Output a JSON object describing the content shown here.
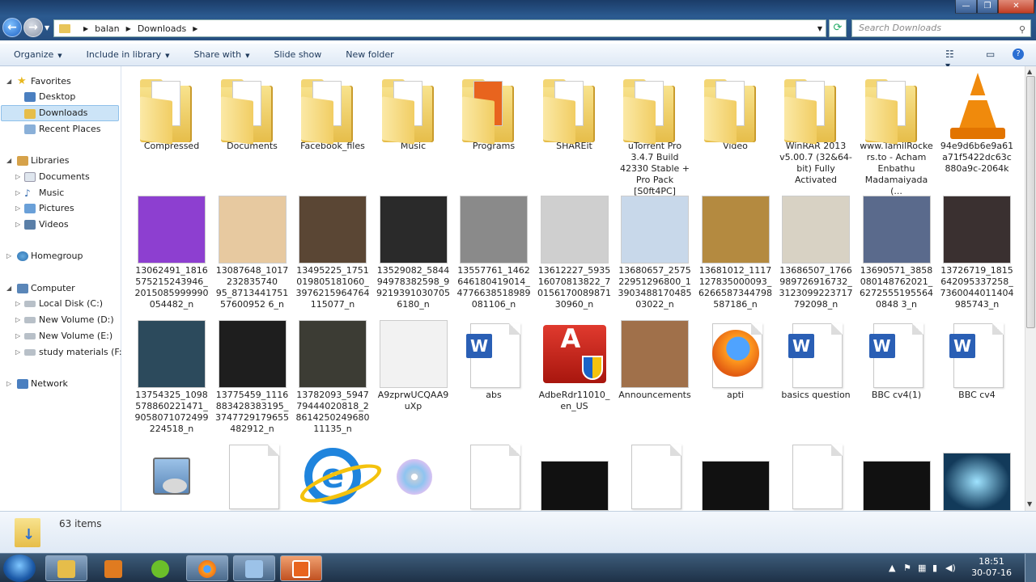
{
  "window": {
    "address": {
      "crumbs": [
        "balan",
        "Downloads"
      ]
    },
    "search_placeholder": "Search Downloads",
    "controls": {
      "minimize": "—",
      "maximize": "❐",
      "close": "✕"
    }
  },
  "toolbar": {
    "items": [
      "Organize",
      "Include in library",
      "Share with",
      "Slide show",
      "New folder"
    ]
  },
  "sidebar": {
    "favorites": {
      "label": "Favorites",
      "items": [
        "Desktop",
        "Downloads",
        "Recent Places"
      ]
    },
    "libraries": {
      "label": "Libraries",
      "items": [
        "Documents",
        "Music",
        "Pictures",
        "Videos"
      ]
    },
    "homegroup": "Homegroup",
    "computer": {
      "label": "Computer",
      "items": [
        "Local Disk (C:)",
        "New Volume (D:)",
        "New Volume (E:)",
        "study materials (F:)"
      ]
    },
    "network": "Network"
  },
  "files": {
    "row1": [
      {
        "name": "Compressed",
        "kind": "folder"
      },
      {
        "name": "Documents",
        "kind": "folder"
      },
      {
        "name": "Facebook_files",
        "kind": "folder"
      },
      {
        "name": "Music",
        "kind": "folder"
      },
      {
        "name": "Programs",
        "kind": "folder",
        "accent": "#e8641e"
      },
      {
        "name": "SHAREit",
        "kind": "folder"
      },
      {
        "name": "uTorrent Pro 3.4.7 Build 42330 Stable + Pro Pack [S0ft4PC]",
        "kind": "folder"
      },
      {
        "name": "Video",
        "kind": "folder"
      },
      {
        "name": "WinRAR 2013 v5.00.7 (32&64-bit) Fully Activated",
        "kind": "folder"
      },
      {
        "name": "www.TamilRockers.to - Acham Enbathu Madamaiyada (...",
        "kind": "folder"
      },
      {
        "name": "94e9d6b6e9a61a71f5422dc63c880a9c-2064k",
        "kind": "vlc"
      }
    ],
    "row2": [
      {
        "name": "13062491_1816575215243946_2015085999990054482_n",
        "color": "#8d3fd0"
      },
      {
        "name": "13087648_1017232835740 95_871344175157600952 6_n",
        "color": "#e7c9a0"
      },
      {
        "name": "13495225_1751019805181060_3976215964764115077_n",
        "color": "#5a4634"
      },
      {
        "name": "13529082_584494978382598_992193910307056180_n",
        "color": "#2a2a2a"
      },
      {
        "name": "13557761_1462646180419014_4776638518989081106_n",
        "color": "#8a8a8a"
      },
      {
        "name": "13612227_593516070813822_7015617008987130960_n",
        "color": "#cfcfcf"
      },
      {
        "name": "13680657_257522951296800_1390348817048503022_n",
        "color": "#c8d8ea"
      },
      {
        "name": "13681012_1117127835000093_6266587344798587186_n",
        "color": "#b48a40"
      },
      {
        "name": "13686507_1766989726916732_3123099223717792098_n",
        "color": "#d8d2c4"
      },
      {
        "name": "13690571_3858080148762021_62725551955640848 3_n",
        "color": "#5a6a8c"
      },
      {
        "name": "13726719_1815642095337258_7360044011404985743_n",
        "color": "#3a3030"
      }
    ],
    "row3": [
      {
        "name": "13754325_1098578860221471_9058071072499224518_n",
        "kind": "photo",
        "color": "#2c4a5c"
      },
      {
        "name": "13775459_1116883428383195_3747729179655482912_n",
        "kind": "photo",
        "color": "#1e1e1e"
      },
      {
        "name": "13782093_594779444020818_2861425024968011135_n",
        "kind": "photo",
        "color": "#3c3c34"
      },
      {
        "name": "A9zprwUCQAA9uXp",
        "kind": "photo",
        "color": "#f2f2f2"
      },
      {
        "name": "abs",
        "kind": "word"
      },
      {
        "name": "AdbeRdr11010_en_US",
        "kind": "adobe"
      },
      {
        "name": "Announcements",
        "kind": "photo",
        "color": "#a0704a"
      },
      {
        "name": "apti",
        "kind": "firefox"
      },
      {
        "name": "basics question",
        "kind": "word"
      },
      {
        "name": "BBC cv4(1)",
        "kind": "word"
      },
      {
        "name": "BBC cv4",
        "kind": "word"
      }
    ],
    "row4": [
      "setup",
      "blank",
      "ie",
      "cd",
      "blank",
      "photo-dark",
      "blank",
      "photo-dark",
      "blank",
      "photo-dark",
      "photo-blue"
    ]
  },
  "status": {
    "count": "63 items"
  },
  "taskbar": {
    "time": "18:51",
    "date": "30-07-16"
  }
}
